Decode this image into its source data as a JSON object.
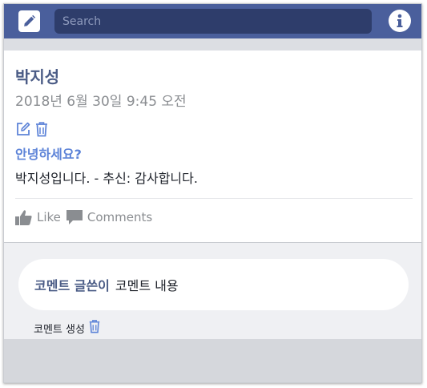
{
  "header": {
    "search_placeholder": "Search",
    "compose_icon": "pencil-icon",
    "info_icon": "info-icon"
  },
  "post": {
    "author": "박지성",
    "date": "2018년 6월 30일 9:45 오전",
    "title": "안녕하세요?",
    "body": "박지성입니다. - 추신: 감사합니다.",
    "edit_icon": "edit-icon",
    "delete_icon": "trash-icon",
    "like_label": "Like",
    "comments_label": "Comments"
  },
  "comments": {
    "items": [
      {
        "author": "코멘트 글쓴이",
        "text": "코멘트 내용"
      }
    ],
    "create_label": "코멘트 생성"
  },
  "colors": {
    "topbar": "#4a5f9c",
    "search_bg": "#2e3d6b",
    "accent": "#5e84d8",
    "author": "#4b5c86",
    "muted": "#8a8d91",
    "comment_area": "#eff0f3"
  }
}
